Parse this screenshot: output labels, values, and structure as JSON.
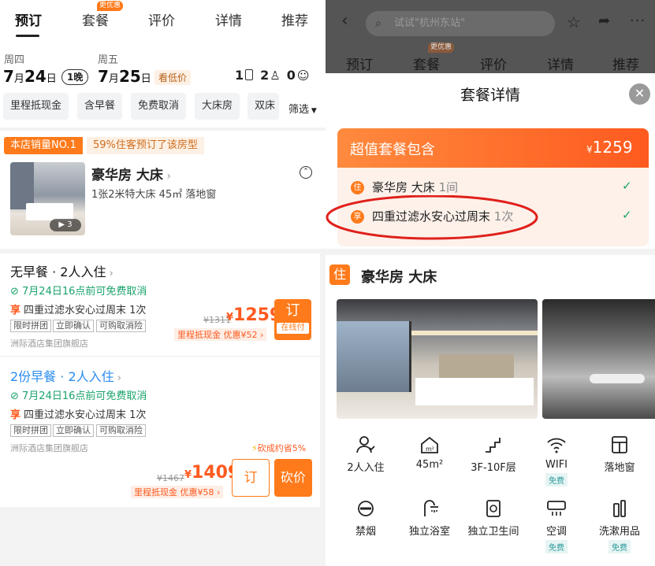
{
  "left": {
    "tabs": [
      {
        "label": "预订"
      },
      {
        "label": "套餐"
      },
      {
        "label": "评价"
      },
      {
        "label": "详情"
      },
      {
        "label": "推荐"
      }
    ],
    "tab_badge": "更优惠",
    "checkin": {
      "dow": "周四",
      "month": "7",
      "day": "24"
    },
    "checkout": {
      "dow": "周五",
      "month": "7",
      "day": "25"
    },
    "unit_month": "月",
    "unit_day": "日",
    "nights": "1晚",
    "low_price": "看低价",
    "rooms": "1",
    "adults": "2",
    "children": "0",
    "filters": [
      "里程抵现金",
      "含早餐",
      "免费取消",
      "大床房",
      "双床"
    ],
    "filter_more": "筛选",
    "rank": "本店销量NO.1",
    "rank_note": "59%住客预订了该房型",
    "room_name": "豪华房 大床",
    "room_desc": "1张2米特大床 45㎡ 落地窗",
    "photo_count": "3",
    "offers": [
      {
        "title": "无早餐 · 2人入住",
        "cancel": "7月24日16点前可免费取消",
        "perk": "四重过滤水安心过周末 1次",
        "tags": [
          "限时拼团",
          "立即确认",
          "可购取消险"
        ],
        "seller": "洲际酒店集团旗舰店",
        "orig": "¥1311",
        "price": "1259",
        "mileage": "里程抵现金",
        "discount": "优惠¥52",
        "book": "订",
        "book_sub": "在线付"
      },
      {
        "title": "2份早餐 · 2人入住",
        "cancel": "7月24日16点前可免费取消",
        "perk": "四重过滤水安心过周末 1次",
        "tags": [
          "限时拼团",
          "立即确认",
          "可购取消险"
        ],
        "seller": "洲际酒店集团旗舰店",
        "orig": "¥1467",
        "price": "1409",
        "mileage": "里程抵现金",
        "discount": "优惠¥58",
        "book": "订",
        "bargain": "砍价",
        "save_note": "砍成约省5%"
      }
    ],
    "perk_icon": "享",
    "currency": "¥"
  },
  "right": {
    "search_placeholder": "试试\"杭州东站\"",
    "tabs": [
      "预订",
      "套餐",
      "评价",
      "详情",
      "推荐"
    ],
    "tab_badge": "更优惠",
    "sheet_title": "套餐详情",
    "package_title": "超值套餐包含",
    "package_price": "1259",
    "items": [
      {
        "icon": "住",
        "name": "豪华房 大床",
        "qty": "1间"
      },
      {
        "icon": "享",
        "name": "四重过滤水安心过周末",
        "qty": "1次"
      }
    ],
    "room_section_icon": "住",
    "room_section_title": "豪华房 大床",
    "amenities": [
      {
        "label": "2人入住"
      },
      {
        "label": "45m²"
      },
      {
        "label": "3F-10F层"
      },
      {
        "label": "WIFI",
        "free": "免费"
      },
      {
        "label": "落地窗"
      },
      {
        "label": "禁烟"
      },
      {
        "label": "独立浴室"
      },
      {
        "label": "独立卫生间"
      },
      {
        "label": "空调",
        "free": "免费"
      },
      {
        "label": "洗漱用品",
        "free": "免费"
      }
    ],
    "highlight_color": "#e0201b"
  }
}
